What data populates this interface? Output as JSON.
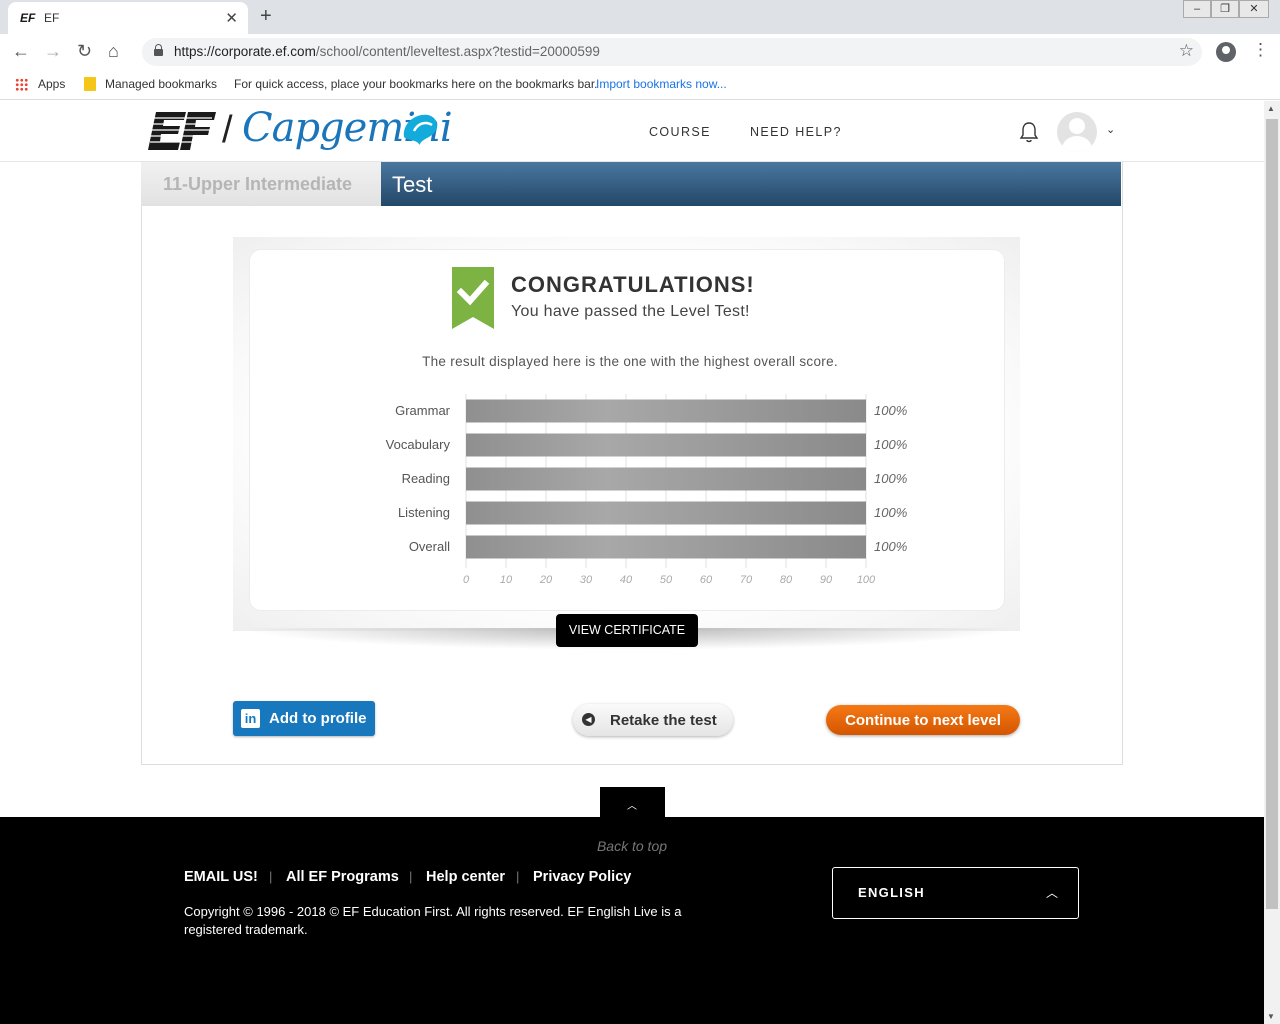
{
  "browser": {
    "tab_title": "EF",
    "tab_favicon": "EF",
    "url_host": "https://corporate.ef.com",
    "url_path": "/school/content/leveltest.aspx?testid=20000599",
    "bookmarks": {
      "apps": "Apps",
      "managed": "Managed bookmarks",
      "hint": "For quick access, place your bookmarks here on the bookmarks bar.",
      "import": "Import bookmarks now..."
    }
  },
  "header": {
    "logo_ef": "EF",
    "logo_brand": "Capgemini",
    "nav": [
      "COURSE",
      "NEED HELP?"
    ]
  },
  "level": {
    "name": "11-Upper Intermediate",
    "section": "Test"
  },
  "result": {
    "heading": "CONGRATULATIONS!",
    "subheading": "You have passed the Level Test!",
    "note": "The result displayed here is the one with the highest overall score.",
    "view_certificate": "VIEW CERTIFICATE"
  },
  "chart_data": {
    "type": "bar",
    "orientation": "horizontal",
    "categories": [
      "Grammar",
      "Vocabulary",
      "Reading",
      "Listening",
      "Overall"
    ],
    "values": [
      100,
      100,
      100,
      100,
      100
    ],
    "value_labels": [
      "100%",
      "100%",
      "100%",
      "100%",
      "100%"
    ],
    "x_ticks": [
      "0",
      "10",
      "20",
      "30",
      "40",
      "50",
      "60",
      "70",
      "80",
      "90",
      "100"
    ],
    "xlim": [
      0,
      100
    ],
    "grid": true,
    "bar_color": "#9a9a9a"
  },
  "actions": {
    "linkedin": "Add to profile",
    "linkedin_icon": "in",
    "retake": "Retake the test",
    "continue": "Continue to next level"
  },
  "footer": {
    "back_to_top": "Back to top",
    "links": [
      "EMAIL US!",
      "All EF Programs",
      "Help center",
      "Privacy Policy"
    ],
    "copyright": "Copyright © 1996 - 2018 © EF Education First. All rights reserved. EF English Live is a registered trademark.",
    "language": "ENGLISH"
  },
  "colors": {
    "brand_blue": "#1b75bb",
    "test_bar": "#2f5a80",
    "accent_orange": "#e8650a",
    "linkedin_blue": "#1878bd",
    "ribbon_green": "#7cb342"
  }
}
